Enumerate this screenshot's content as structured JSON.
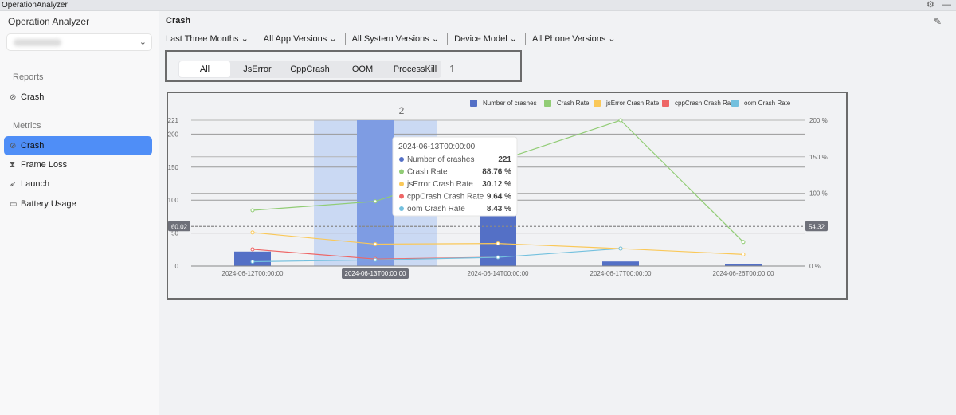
{
  "window": {
    "title": "OperationAnalyzer",
    "settings_icon": "gear-icon",
    "minimize_icon": "minimize-icon"
  },
  "sidebar": {
    "app_title": "Operation Analyzer",
    "project_select": {
      "value": ""
    },
    "reports_label": "Reports",
    "reports": [
      {
        "label": "Crash",
        "icon": "crash-icon"
      }
    ],
    "metrics_label": "Metrics",
    "metrics": [
      {
        "label": "Crash",
        "icon": "crash-icon",
        "active": true
      },
      {
        "label": "Frame Loss",
        "icon": "hourglass-icon"
      },
      {
        "label": "Launch",
        "icon": "rocket-icon"
      },
      {
        "label": "Battery Usage",
        "icon": "battery-icon"
      }
    ]
  },
  "main": {
    "title": "Crash",
    "filters": [
      "Last Three Months",
      "All App Versions",
      "All System Versions",
      "Device Model",
      "All Phone Versions"
    ],
    "tabs": [
      {
        "label": "All",
        "active": true
      },
      {
        "label": "JsError"
      },
      {
        "label": "CppCrash"
      },
      {
        "label": "OOM"
      },
      {
        "label": "ProcessKill"
      }
    ],
    "annotation_1": "1",
    "annotation_2": "2"
  },
  "colors": {
    "bars": "#5470c6",
    "crash_rate": "#91cc75",
    "jserror": "#fac858",
    "cppcrash": "#ee6666",
    "oom": "#73c0de",
    "active_nav": "#4f8ef7"
  },
  "chart_data": {
    "type": "bar+line",
    "categories": [
      "2024-06-12T00:00:00",
      "2024-06-13T00:00:00",
      "2024-06-14T00:00:00",
      "2024-06-17T00:00:00",
      "2024-06-26T00:00:00"
    ],
    "y_left": {
      "ticks": [
        "0",
        "50",
        "100",
        "150",
        "200",
        "221"
      ],
      "range": [
        0,
        221
      ]
    },
    "y_right": {
      "ticks": [
        "0 %",
        "100 %",
        "150 %",
        "200 %"
      ],
      "range": [
        0,
        200
      ]
    },
    "series": [
      {
        "name": "Number of crashes",
        "type": "bar",
        "axis": "left",
        "values": [
          22,
          221,
          76,
          7,
          3
        ]
      },
      {
        "name": "Crash Rate",
        "type": "line",
        "axis": "right",
        "values": [
          76.5,
          88.76,
          144,
          200,
          33
        ]
      },
      {
        "name": "jsError Crash Rate",
        "type": "line",
        "axis": "right",
        "values": [
          46,
          30.12,
          31,
          24,
          16
        ]
      },
      {
        "name": "cppCrash Crash Rate",
        "type": "line",
        "axis": "right",
        "values": [
          23,
          9.64,
          12,
          null,
          null
        ]
      },
      {
        "name": "oom Crash Rate",
        "type": "line",
        "axis": "right",
        "values": [
          6,
          8.43,
          12,
          24,
          null
        ]
      }
    ],
    "mark_lines": {
      "left": "60.02",
      "right": "54.32"
    },
    "legend": "top-right",
    "grid": true,
    "highlighted_category": "2024-06-13T00:00:00",
    "tooltip": {
      "title": "2024-06-13T00:00:00",
      "rows": [
        {
          "name": "Number of crashes",
          "value": "221"
        },
        {
          "name": "Crash Rate",
          "value": "88.76 %"
        },
        {
          "name": "jsError Crash Rate",
          "value": "30.12 %"
        },
        {
          "name": "cppCrash Crash Rate",
          "value": "9.64 %"
        },
        {
          "name": "oom Crash Rate",
          "value": "8.43 %"
        }
      ]
    }
  }
}
